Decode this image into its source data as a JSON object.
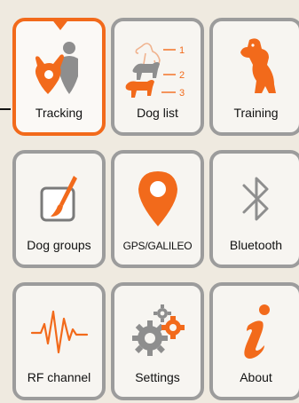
{
  "colors": {
    "accent": "#f26a1b",
    "tile_border": "#9c9c9c",
    "tile_bg": "#f7f5f1",
    "screen_bg": "#efeae0",
    "icon_gray": "#8e8e8e"
  },
  "tiles": [
    {
      "label": "Tracking",
      "icon": "tracking-dog-pin-icon",
      "active": true
    },
    {
      "label": "Dog list",
      "icon": "dog-list-icon",
      "active": false
    },
    {
      "label": "Training",
      "icon": "sitting-dog-icon",
      "active": false
    },
    {
      "label": "Dog groups",
      "icon": "brush-icon",
      "active": false
    },
    {
      "label": "GPS/GALILEO",
      "icon": "location-pin-icon",
      "active": false
    },
    {
      "label": "Bluetooth",
      "icon": "bluetooth-icon",
      "active": false
    },
    {
      "label": "RF channel",
      "icon": "waveform-icon",
      "active": false
    },
    {
      "label": "Settings",
      "icon": "gears-icon",
      "active": false
    },
    {
      "label": "About",
      "icon": "info-icon",
      "active": false
    }
  ],
  "dog_list_numbers": [
    "1",
    "2",
    "3"
  ]
}
